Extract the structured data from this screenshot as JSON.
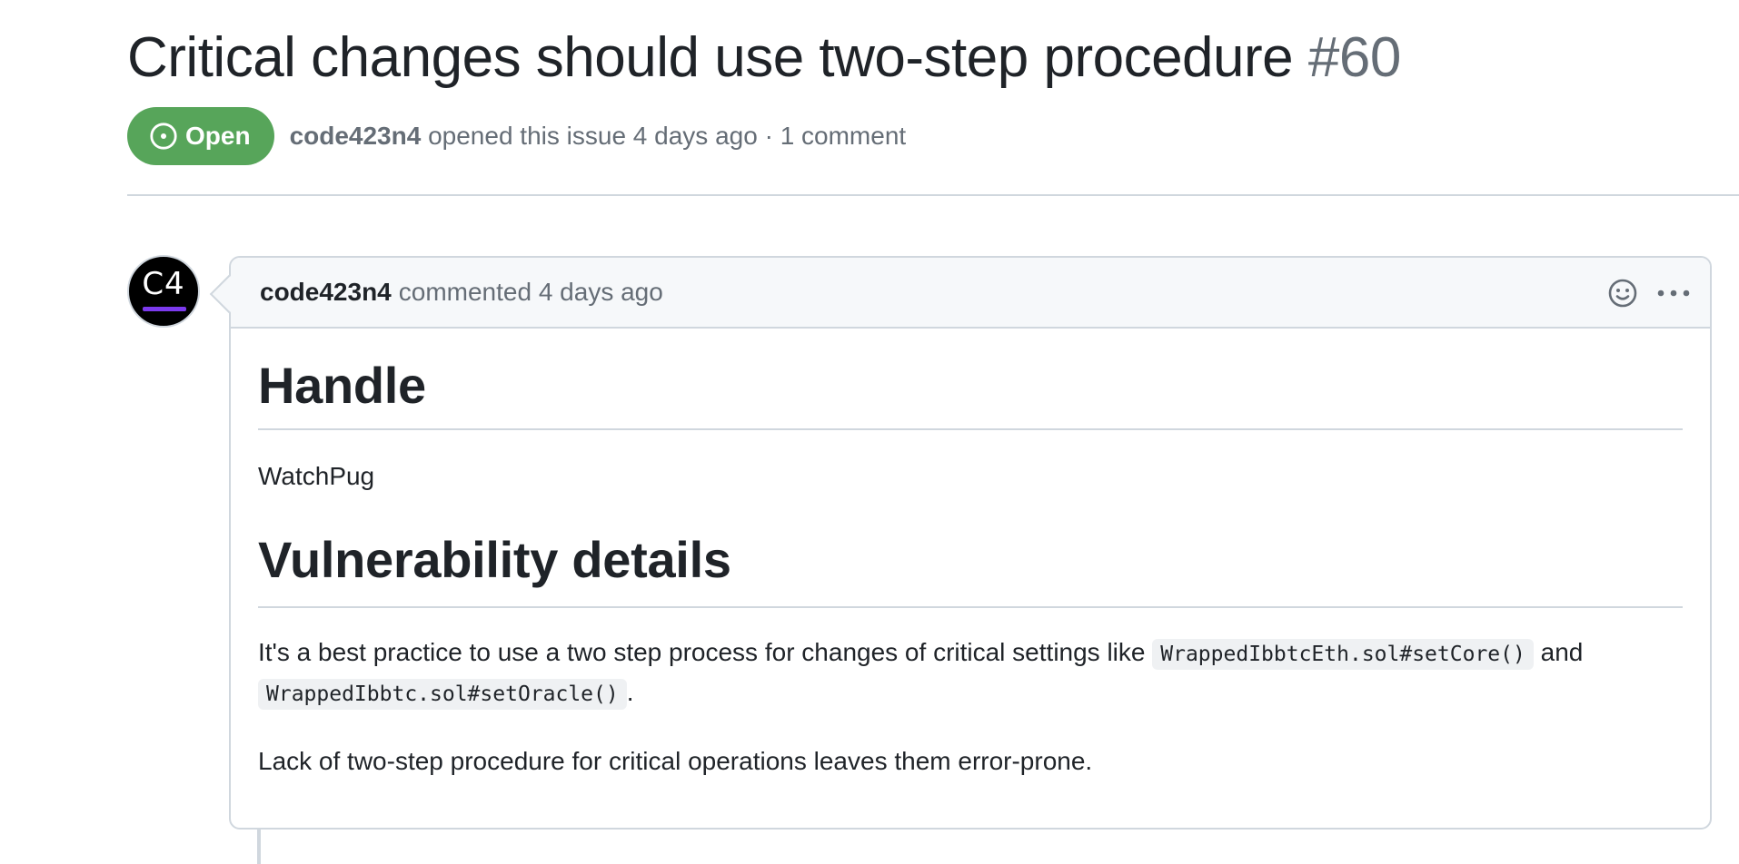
{
  "issue": {
    "title": "Critical changes should use two-step procedure",
    "number": "#60",
    "state": "Open",
    "author": "code423n4",
    "opened_text": "opened this issue 4 days ago",
    "separator": "·",
    "comment_count": "1 comment"
  },
  "comment": {
    "avatar_text": "C4",
    "author": "code423n4",
    "action_text": "commented 4 days ago",
    "body": {
      "heading_handle": "Handle",
      "handle_value": "WatchPug",
      "heading_details": "Vulnerability details",
      "details_text_1": "It's a best practice to use a two step process for changes of critical settings like ",
      "code_1": "WrappedIbbtcEth.sol#setCore()",
      "details_text_2": " and",
      "code_2": "WrappedIbbtc.sol#setOracle()",
      "details_text_3": ".",
      "lack_text": "Lack of two-step procedure for critical operations leaves them error-prone."
    }
  },
  "colors": {
    "open_badge": "#57a55a",
    "muted_text": "#656d76",
    "border": "#d0d7de",
    "avatar_accent": "#7c3aed"
  },
  "icons": {
    "state": "issue-opened-icon",
    "reaction": "smiley-icon",
    "more": "kebab-horizontal-icon"
  }
}
